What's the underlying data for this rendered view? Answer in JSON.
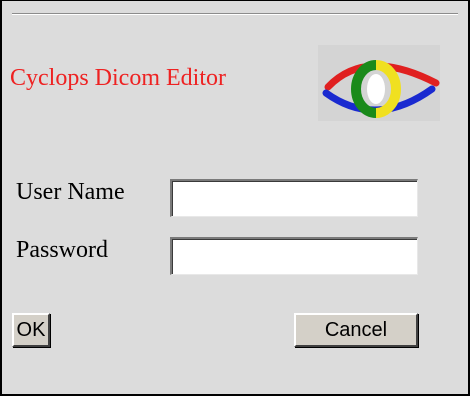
{
  "app": {
    "title": "Cyclops Dicom Editor"
  },
  "logo": {
    "icon": "eye-logo-icon",
    "colors": {
      "upper_arc": "#e02020",
      "lower_arc": "#1a2ad0",
      "left_iris": "#1a8a1a",
      "right_iris": "#f0e020",
      "pupil": "#ffffff"
    }
  },
  "form": {
    "username": {
      "label": "User Name",
      "value": "",
      "placeholder": ""
    },
    "password": {
      "label": "Password",
      "value": "",
      "placeholder": ""
    }
  },
  "buttons": {
    "ok_label": "OK",
    "cancel_label": "Cancel"
  },
  "colors": {
    "title_text": "#ee2222",
    "dialog_background": "#dcdcdc"
  }
}
